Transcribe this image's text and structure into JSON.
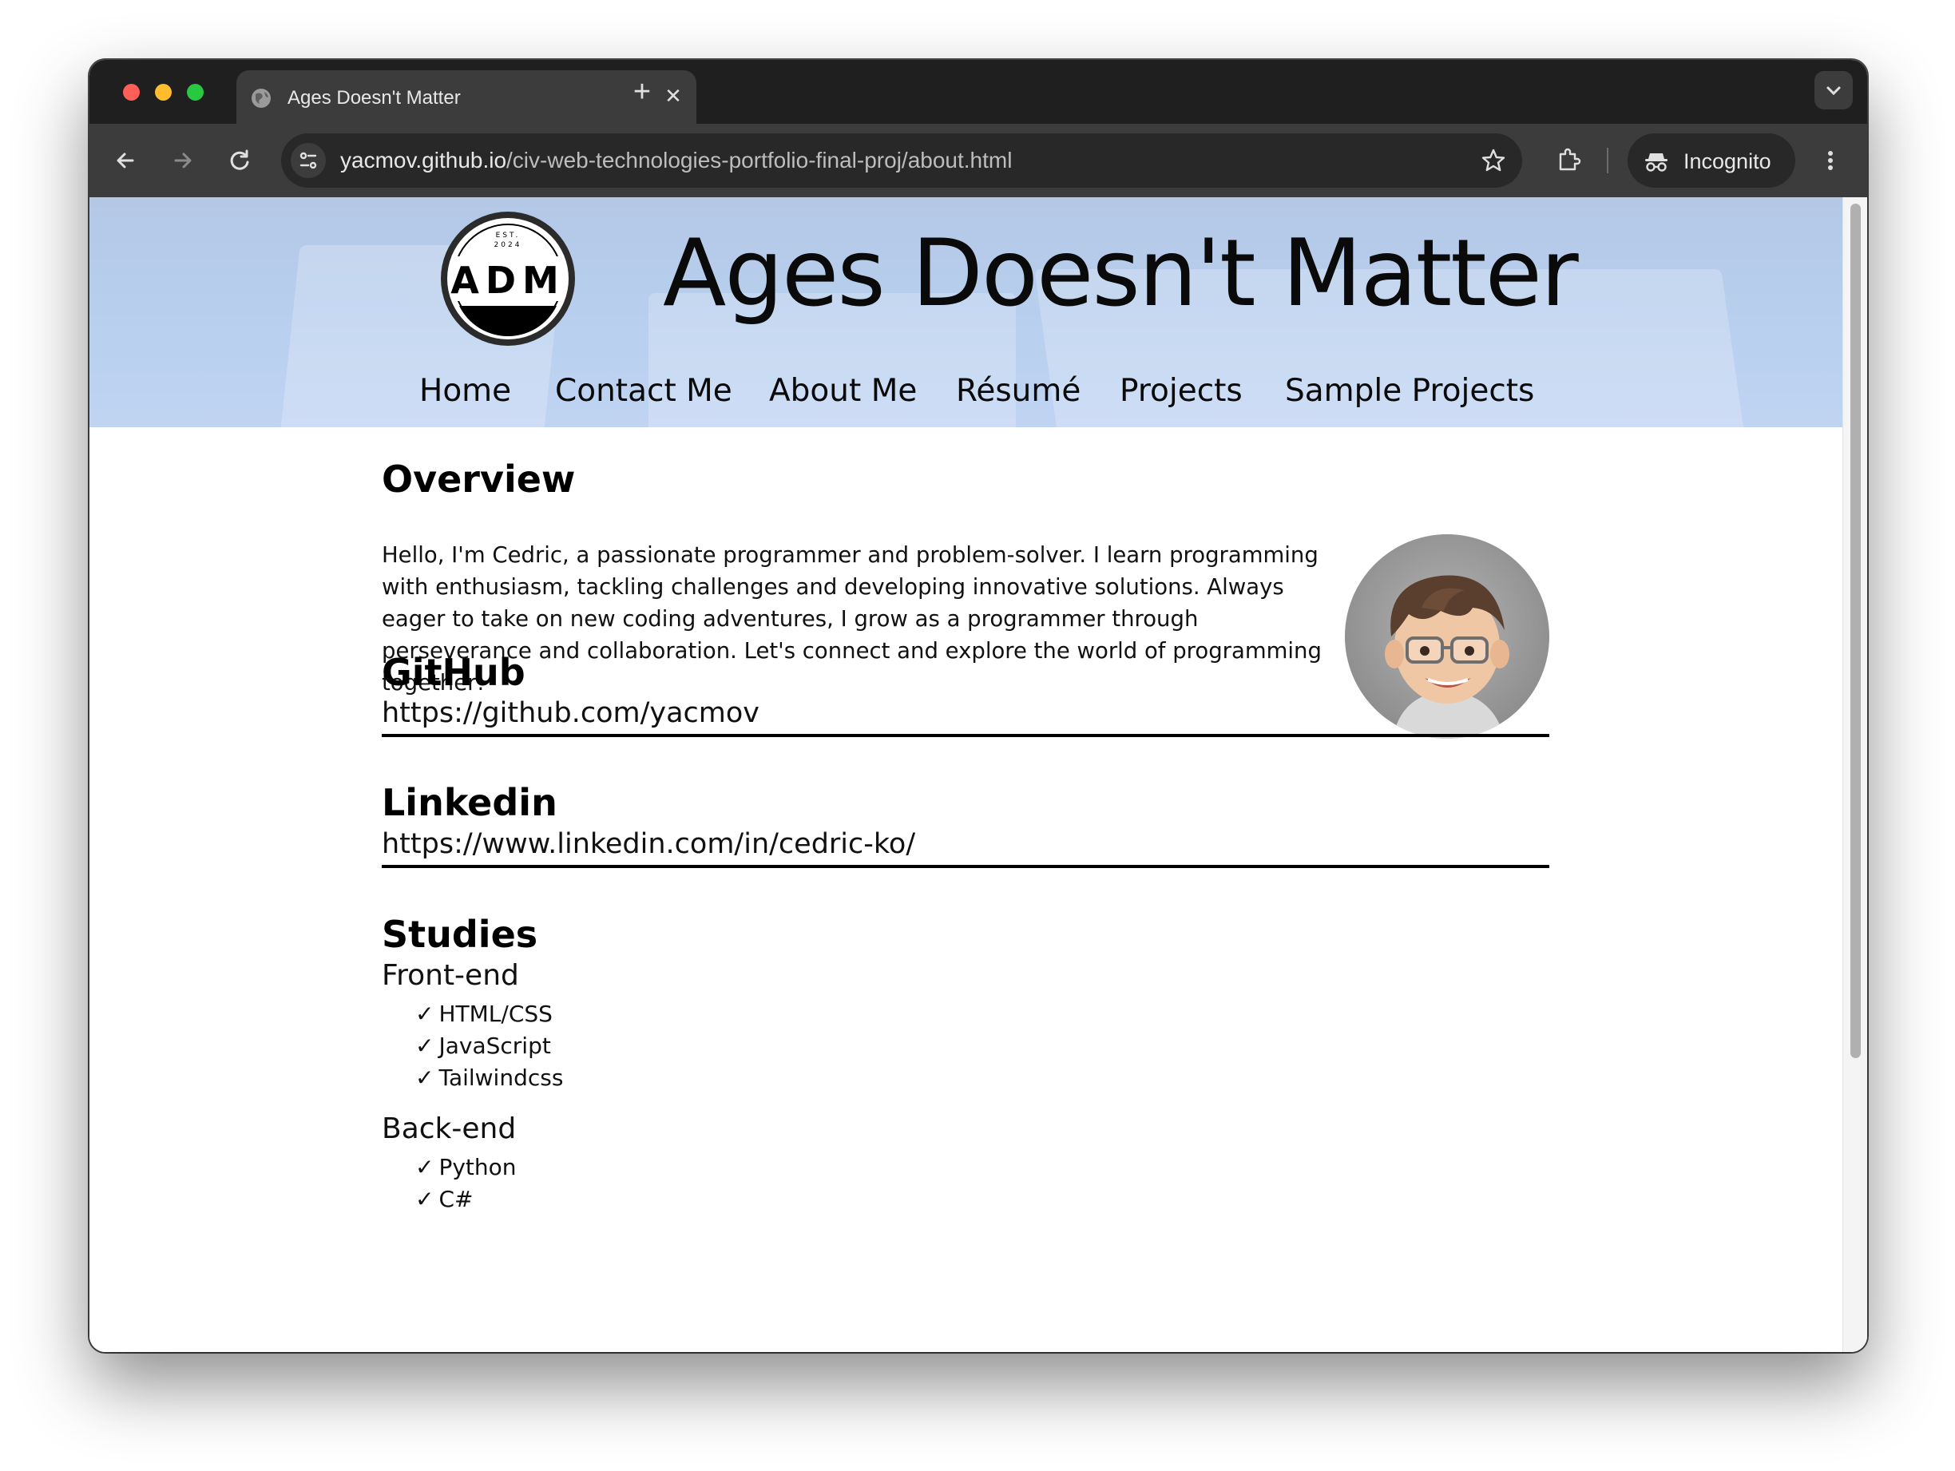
{
  "browser": {
    "tab_title": "Ages Doesn't Matter",
    "url_host": "yacmov.github.io",
    "url_path": "/civ-web-technologies-portfolio-final-proj/about.html",
    "incognito_label": "Incognito"
  },
  "site": {
    "logo_text": "ADM",
    "logo_est": "EST.",
    "logo_year": "2024",
    "title": "Ages Doesn't Matter",
    "nav": [
      "Home",
      "Contact Me",
      "About Me",
      "Résumé",
      "Projects",
      "Sample Projects"
    ]
  },
  "overview": {
    "heading": "Overview",
    "text": "Hello, I'm Cedric, a passionate programmer and problem-solver. I learn programming with enthusiasm, tackling challenges and developing innovative solutions. Always eager to take on new coding adventures, I grow as a programmer through perseverance and collaboration. Let's connect and explore the world of programming together!"
  },
  "github": {
    "heading": "GitHub",
    "url": "https://github.com/yacmov"
  },
  "linkedin": {
    "heading": "Linkedin",
    "url": "https://www.linkedin.com/in/cedric-ko/"
  },
  "studies": {
    "heading": "Studies",
    "groups": [
      {
        "title": "Front-end",
        "items": [
          "HTML/CSS",
          "JavaScript",
          "Tailwindcss"
        ]
      },
      {
        "title": "Back-end",
        "items": [
          "Python",
          "C#"
        ]
      }
    ],
    "check_mark": "✓"
  }
}
